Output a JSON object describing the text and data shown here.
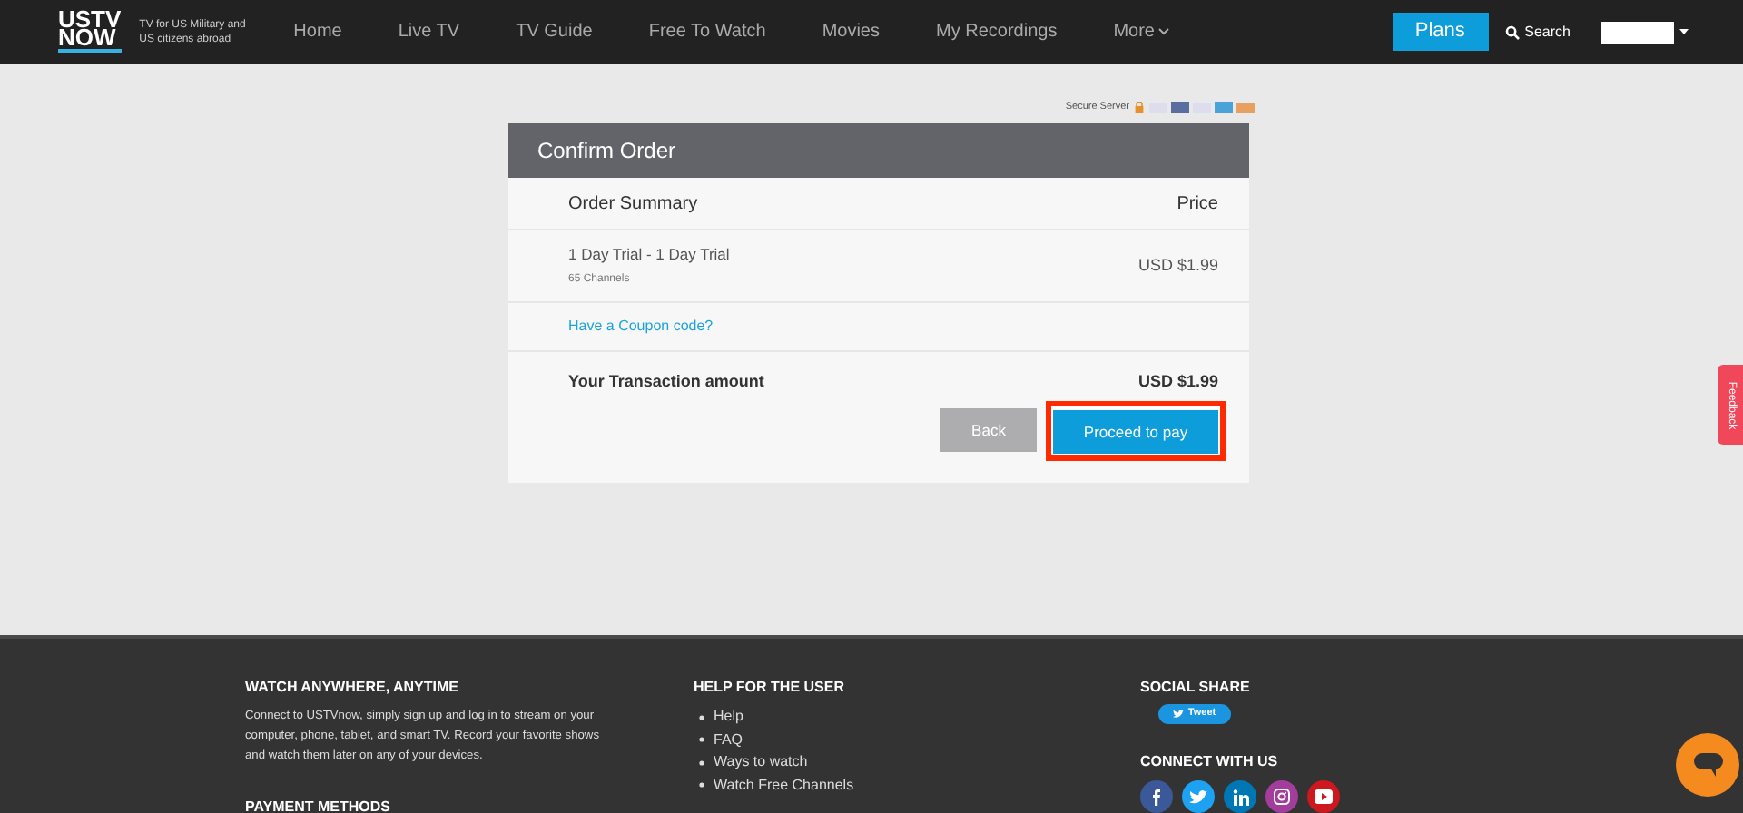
{
  "header": {
    "logo": [
      "USTV",
      "NOW"
    ],
    "tagline": "TV for US Military and US citizens abroad",
    "nav": [
      "Home",
      "Live TV",
      "TV Guide",
      "Free To Watch",
      "Movies",
      "My Recordings",
      "More"
    ],
    "plans_button": "Plans",
    "search_label": "Search"
  },
  "secure_label": "Secure Server",
  "order": {
    "title": "Confirm Order",
    "col_item": "Order Summary",
    "col_price": "Price",
    "items": [
      {
        "name": "1 Day Trial - 1 Day Trial",
        "detail": "65 Channels",
        "price": "USD $1.99"
      }
    ],
    "coupon_link": "Have a Coupon code?",
    "total_label": "Your Transaction amount",
    "total": "USD $1.99",
    "buttons": [
      {
        "kind": "secondary",
        "label": "Back",
        "highlighted": false
      },
      {
        "kind": "primary",
        "label": "Proceed to pay",
        "highlighted": true
      }
    ]
  },
  "feedback_tab": "Feedback",
  "footer": {
    "about_title": "WATCH ANYWHERE, ANYTIME",
    "about_text": "Connect to USTVnow, simply sign up and log in to stream on your computer, phone, tablet, and smart TV. Record your favorite shows and watch them later on any of your devices.",
    "payment_title": "PAYMENT METHODS",
    "help_title": "HELP FOR THE USER",
    "help_links": [
      "Help",
      "FAQ",
      "Ways to watch",
      "Watch Free Channels"
    ],
    "social_title": "SOCIAL SHARE",
    "tweet_button": "Tweet",
    "connect_title": "CONNECT WITH US",
    "social_icons": [
      {
        "kind": "facebook",
        "color": "#3b5998"
      },
      {
        "kind": "twitter",
        "color": "#1da1f2"
      },
      {
        "kind": "linkedin",
        "color": "#0077b5"
      },
      {
        "kind": "instagram",
        "color": "#a23d9c"
      },
      {
        "kind": "youtube",
        "color": "#cc181e"
      }
    ]
  }
}
